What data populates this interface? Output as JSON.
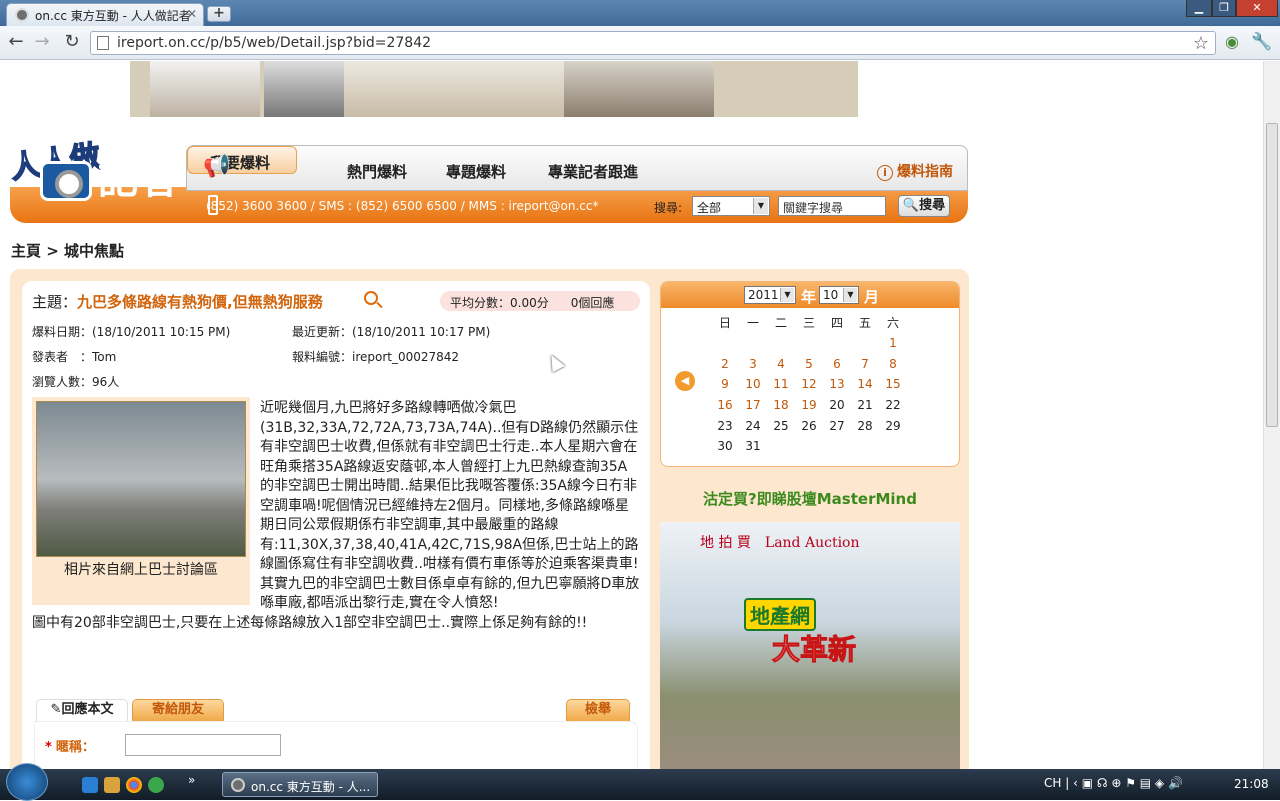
{
  "browser": {
    "tab_title": "on.cc 東方互動 - 人人做記者",
    "new_tab_label": "+",
    "url": "ireport.on.cc/p/b5/web/Detail.jsp?bid=27842"
  },
  "site": {
    "logo_line1": "人人做",
    "logo_line2": "記者",
    "nav": [
      "我要爆料",
      "熱門爆料",
      "專題爆料",
      "專業記者跟進"
    ],
    "guide_label": "爆料指南",
    "contact": "(852) 3600 3600 / SMS : (852) 6500 6500 / MMS : ireport@on.cc*",
    "search_label": "搜尋:",
    "search_scope": "全部",
    "search_value": "關鍵字搜尋",
    "search_button": "搜尋"
  },
  "breadcrumb": "主頁 > 城中焦點",
  "article": {
    "subject_label": "主題：",
    "subject": "九巴多條路線有熱狗價,但無熱狗服務",
    "avg_score": "平均分數：0.00分",
    "replies": "0個回應",
    "report_date": "爆料日期：(18/10/2011 10:15 PM)",
    "last_update": "最近更新：(18/10/2011 10:17 PM)",
    "author": "發表者　：Tom",
    "report_no": "報料編號：ireport_00027842",
    "views": "瀏覽人數：96人",
    "photo_caption": "相片來自網上巴士討論區",
    "body": "近呢幾個月,九巴將好多路線轉哂做冷氣巴(31B,32,33A,72,72A,73,73A,74A)..但有D路線仍然顯示住有非空調巴士收費,但係就有非空調巴士行走..本人星期六會在旺角乘搭35A路線返安蔭邨,本人曾經打上九巴熱線查詢35A的非空調巴士開出時間..結果佢比我嘅答覆係:35A線今日冇非空調車喎!呢個情況已經維持左2個月。同樣地,多條路線喺星期日同公眾假期係冇非空調車,其中最嚴重的路線有:11,30X,37,38,40,41A,42C,71S,98A但係,巴士站上的路線圖係寫住有非空調收費..咁樣有價冇車係等於迫乘客渠貴車!其實九巴的非空調巴士數目係卓卓有餘的,但九巴寧願將D車放喺車廠,都唔派出黎行走,實在令人憤怒!\n圖中有20部非空調巴士,只要在上述每條路線放入1部空非空調巴士..實際上係足夠有餘的!!",
    "tabs": [
      "回應本文",
      "寄給朋友",
      "檢舉"
    ],
    "nickname_label": "暱稱："
  },
  "calendar": {
    "year": "2011",
    "year_unit": "年",
    "month": "10",
    "month_unit": "月",
    "weekdays": [
      "日",
      "一",
      "二",
      "三",
      "四",
      "五",
      "六"
    ],
    "weeks": [
      [
        "",
        "",
        "",
        "",
        "",
        "",
        "1"
      ],
      [
        "2",
        "3",
        "4",
        "5",
        "6",
        "7",
        "8"
      ],
      [
        "9",
        "10",
        "11",
        "12",
        "13",
        "14",
        "15"
      ],
      [
        "16",
        "17",
        "18",
        "19",
        "20",
        "21",
        "22"
      ],
      [
        "23",
        "24",
        "25",
        "26",
        "27",
        "28",
        "29"
      ],
      [
        "30",
        "31",
        "",
        "",
        "",
        "",
        ""
      ]
    ],
    "linked_days_up_to": 19
  },
  "sidebar": {
    "promo_title": "沽定買?即睇股壇MasterMind",
    "ad_line1": "地 拍 買　Land Auction",
    "ad_line2": "地產網",
    "ad_line3": "大革新"
  },
  "taskbar": {
    "task_label": "on.cc 東方互動 - 人...",
    "lang": "CH",
    "time": "21:08"
  },
  "colors": {
    "accent_orange": "#e97412",
    "link_orange": "#c2580a",
    "promo_green": "#3c8a1e"
  }
}
